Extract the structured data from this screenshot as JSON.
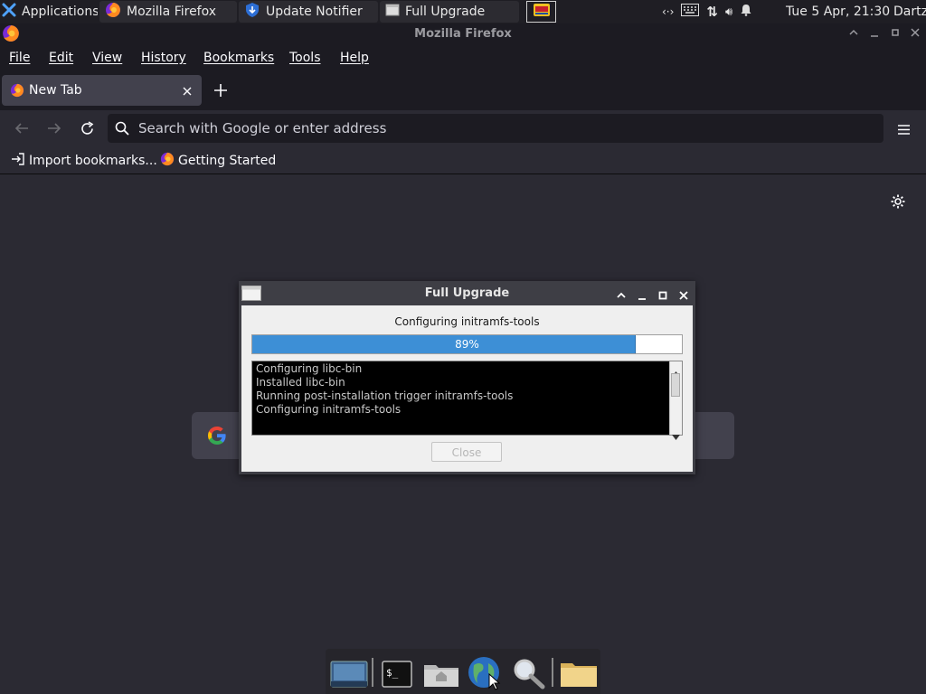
{
  "panel": {
    "applications_label": "Applications",
    "tasks": [
      {
        "label": "Mozilla Firefox"
      },
      {
        "label": "Update Notifier"
      },
      {
        "label": "Full Upgrade"
      }
    ],
    "clock": "Tue  5 Apr, 21:30",
    "user": "Dartz"
  },
  "window": {
    "title": "Mozilla Firefox"
  },
  "menubar": {
    "items": [
      "File",
      "Edit",
      "View",
      "History",
      "Bookmarks",
      "Tools",
      "Help"
    ]
  },
  "tabs": [
    {
      "label": "New Tab"
    }
  ],
  "urlbar": {
    "placeholder": "Search with Google or enter address"
  },
  "bookmarks": {
    "items": [
      {
        "label": "Import bookmarks..."
      },
      {
        "label": "Getting Started"
      }
    ]
  },
  "dialog": {
    "title": "Full Upgrade",
    "status": "Configuring initramfs-tools",
    "progress_percent": 89,
    "progress_label": "89%",
    "log_lines": [
      "Configuring libc-bin",
      "Installed libc-bin",
      "Running post-installation trigger initramfs-tools",
      "Configuring initramfs-tools"
    ],
    "close_label": "Close"
  },
  "colors": {
    "firefox_bg": "#2b2a33",
    "toolbar_bg": "#1c1b22",
    "accent_progress": "#3d8fd6"
  }
}
